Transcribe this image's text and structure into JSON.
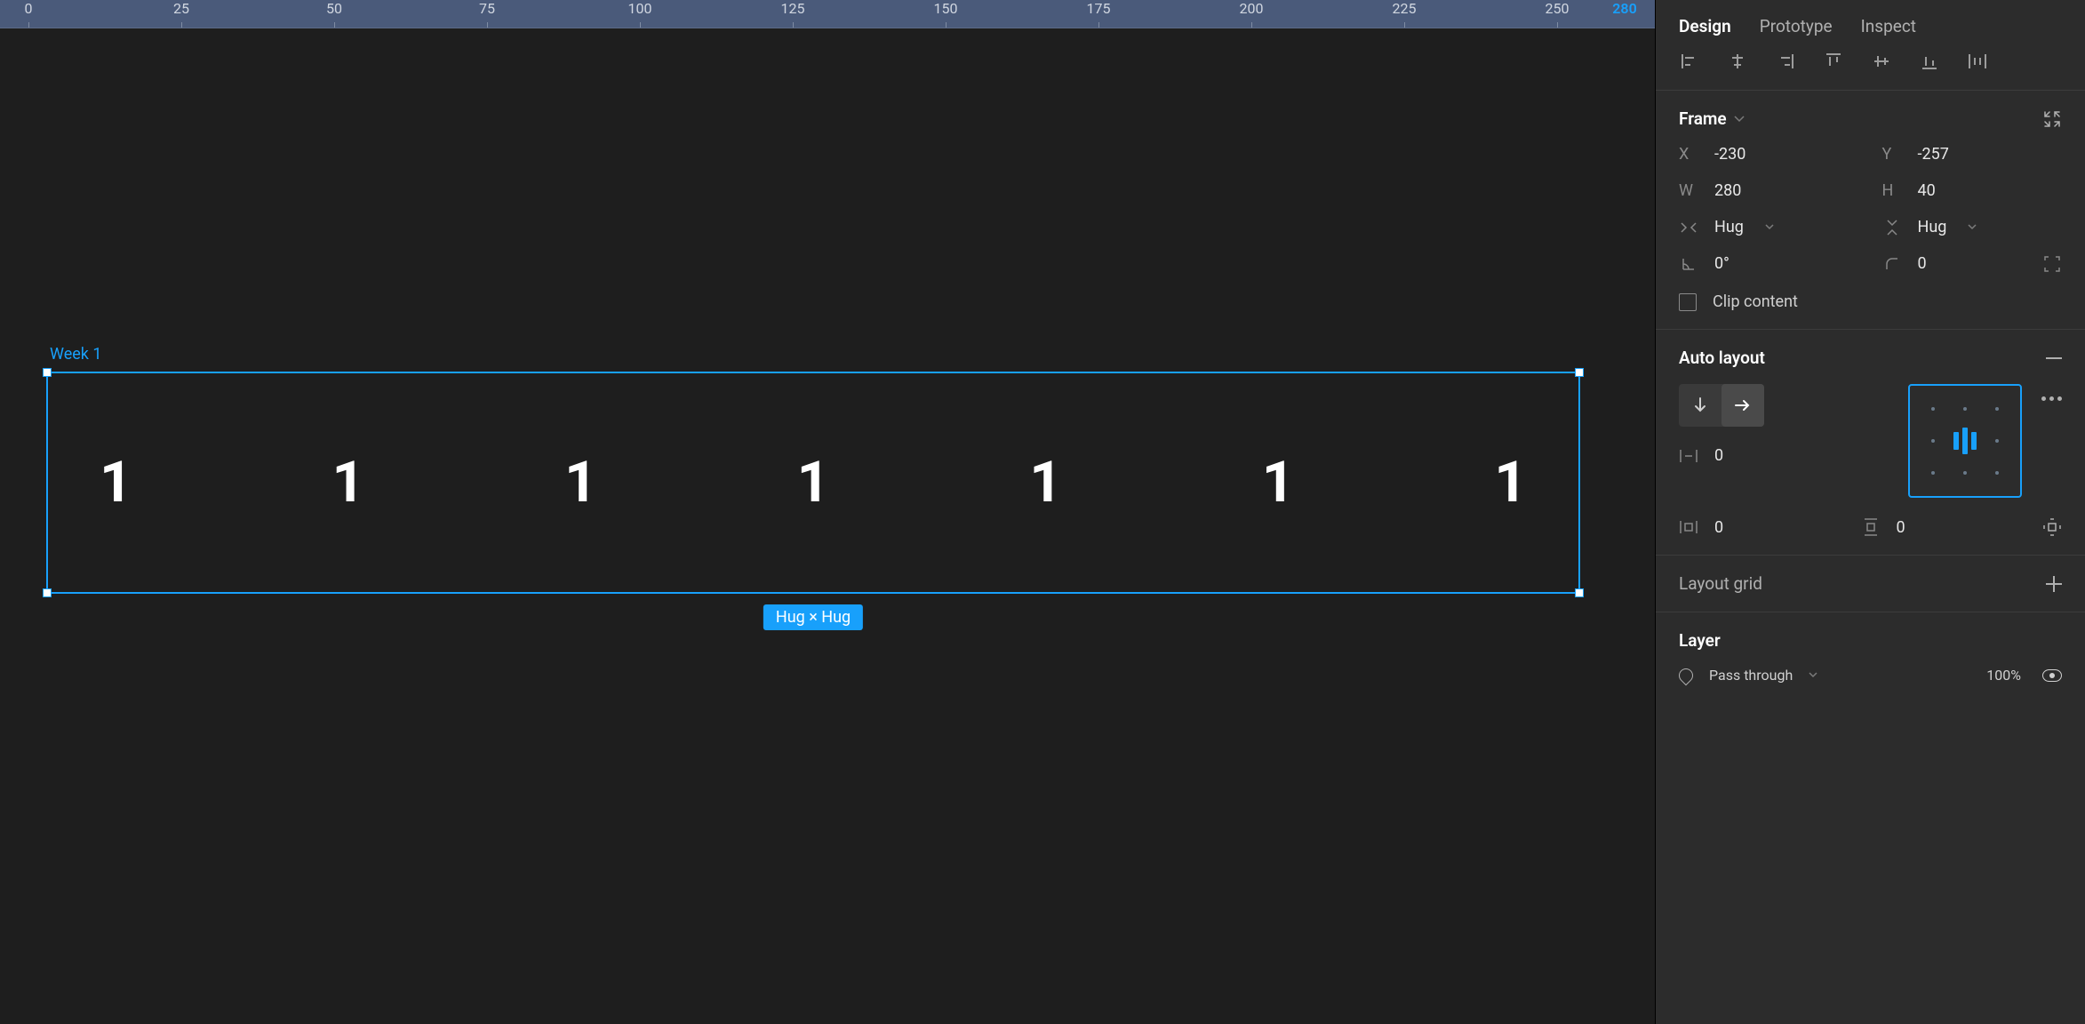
{
  "ruler": {
    "ticks": [
      {
        "label": "0",
        "pos": 32
      },
      {
        "label": "25",
        "pos": 204
      },
      {
        "label": "50",
        "pos": 376
      },
      {
        "label": "75",
        "pos": 548
      },
      {
        "label": "100",
        "pos": 720
      },
      {
        "label": "125",
        "pos": 892
      },
      {
        "label": "150",
        "pos": 1064
      },
      {
        "label": "175",
        "pos": 1236
      },
      {
        "label": "200",
        "pos": 1408
      },
      {
        "label": "225",
        "pos": 1580
      },
      {
        "label": "250",
        "pos": 1752
      }
    ],
    "current": {
      "label": "280",
      "pos": 1828
    }
  },
  "canvas": {
    "frame_label": "Week 1",
    "cells": [
      "1",
      "1",
      "1",
      "1",
      "1",
      "1",
      "1"
    ],
    "size_badge": "Hug × Hug"
  },
  "panel": {
    "tabs": {
      "design": "Design",
      "prototype": "Prototype",
      "inspect": "Inspect",
      "active": "design"
    },
    "frame": {
      "title": "Frame",
      "x_label": "X",
      "x": "-230",
      "y_label": "Y",
      "y": "-257",
      "w_label": "W",
      "w": "280",
      "h_label": "H",
      "h": "40",
      "hug_h": "Hug",
      "hug_v": "Hug",
      "rotation": "0°",
      "radius": "0",
      "clip": "Clip content"
    },
    "auto_layout": {
      "title": "Auto layout",
      "spacing": "0",
      "pad_h": "0",
      "pad_v": "0"
    },
    "layout_grid": {
      "title": "Layout grid"
    },
    "layer": {
      "title": "Layer",
      "blend": "Pass through",
      "opacity": "100%"
    }
  }
}
